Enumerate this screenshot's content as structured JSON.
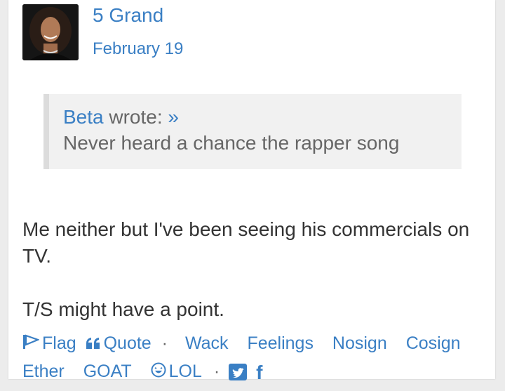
{
  "post": {
    "author": "5 Grand",
    "date": "February 19",
    "quote": {
      "user": "Beta",
      "wrote": "wrote:",
      "arrow": "»",
      "text": "Never heard a chance the rapper song"
    },
    "body": [
      "Me neither but I've been seeing his commercials on TV.",
      "T/S might have a point."
    ],
    "actions": {
      "flag": "Flag",
      "quote": "Quote",
      "separator": "·",
      "reactions": [
        "Wack",
        "Feelings",
        "Nosign",
        "Cosign",
        "Ether",
        "GOAT"
      ],
      "lol": "LOL",
      "facebook": "f"
    }
  },
  "colors": {
    "link": "#3a7fc4",
    "text": "#333333",
    "quote_bg": "#f1f1f1"
  }
}
